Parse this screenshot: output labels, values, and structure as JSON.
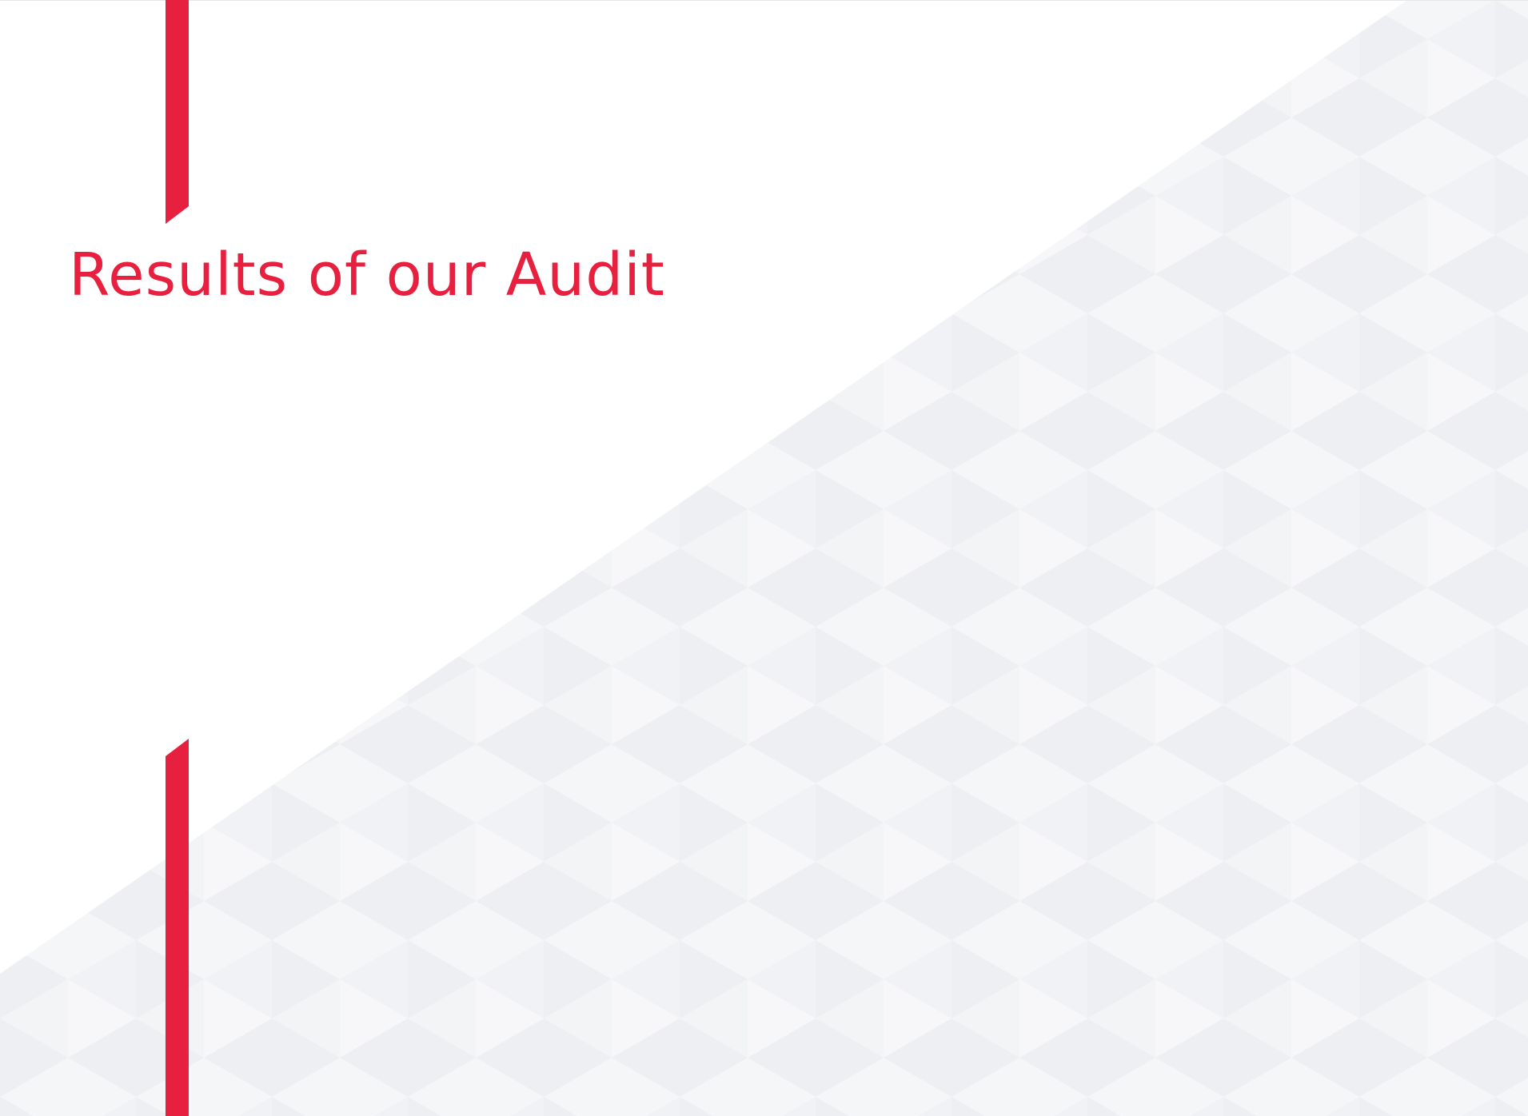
{
  "slide": {
    "title": "Results of our Audit"
  },
  "colors": {
    "accent": "#e8203f",
    "pattern_light": "#f5f6f8",
    "pattern_dark": "#eeeff2",
    "background": "#ffffff"
  }
}
